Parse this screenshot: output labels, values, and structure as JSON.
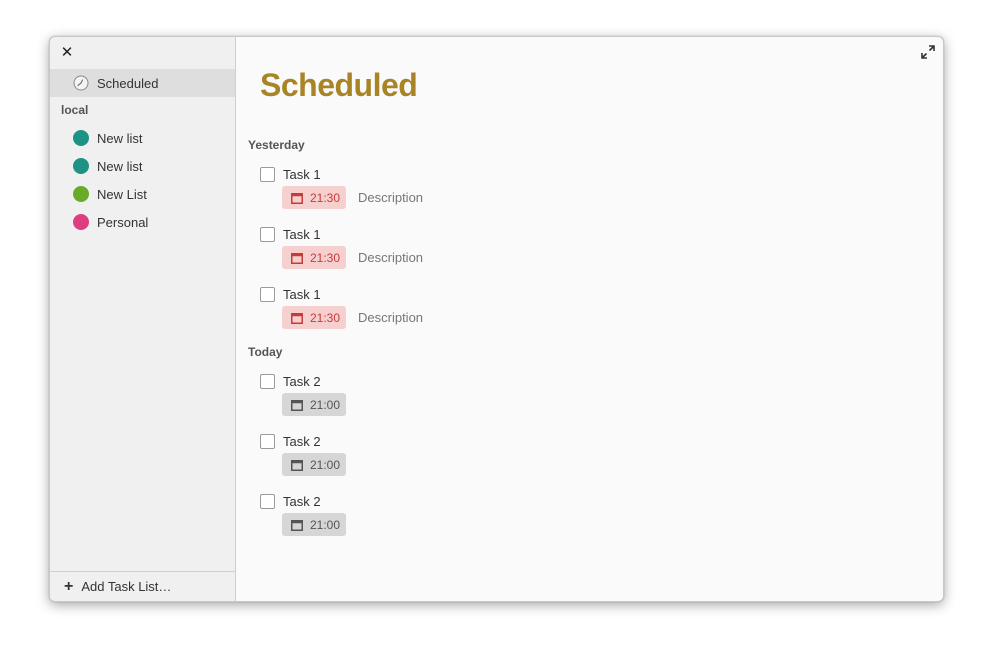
{
  "sidebar": {
    "scheduled_label": "Scheduled",
    "group_label": "local",
    "lists": [
      {
        "label": "New list",
        "color": "#1e9284"
      },
      {
        "label": "New list",
        "color": "#1e9284"
      },
      {
        "label": "New List",
        "color": "#6aaa2a"
      },
      {
        "label": "Personal",
        "color": "#de3e80"
      }
    ],
    "add_label": "Add Task List…"
  },
  "main": {
    "title": "Scheduled",
    "sections": [
      {
        "heading": "Yesterday",
        "tasks": [
          {
            "title": "Task 1",
            "time": "21:30",
            "description": "Description"
          },
          {
            "title": "Task 1",
            "time": "21:30",
            "description": "Description"
          },
          {
            "title": "Task 1",
            "time": "21:30",
            "description": "Description"
          }
        ]
      },
      {
        "heading": "Today",
        "tasks": [
          {
            "title": "Task 2",
            "time": "21:00"
          },
          {
            "title": "Task 2",
            "time": "21:00"
          },
          {
            "title": "Task 2",
            "time": "21:00"
          }
        ]
      }
    ]
  },
  "colors": {
    "title": "#a88426",
    "overdue_bg": "#f6cfcf",
    "overdue_text": "#c83b3b",
    "badge_bg": "#d6d6d6"
  }
}
